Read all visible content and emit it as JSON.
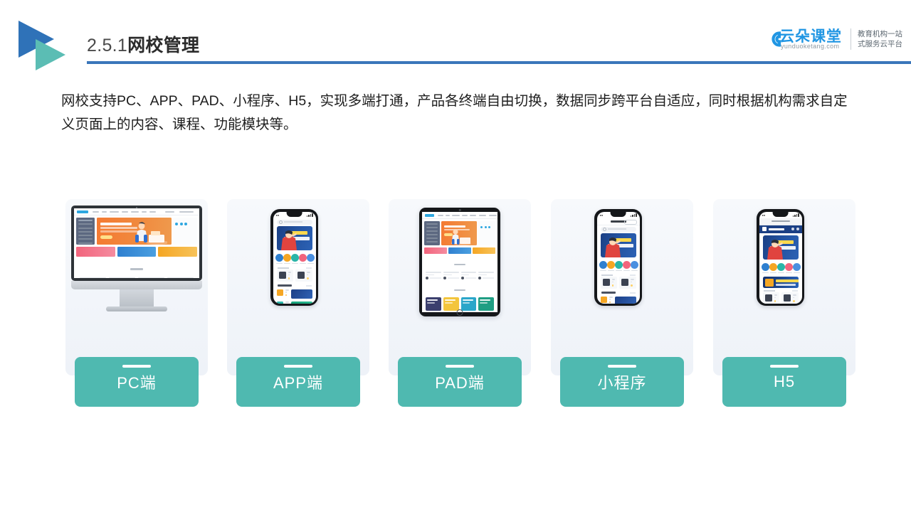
{
  "header": {
    "title_number": "2.5.1",
    "title_zh": "网校管理",
    "rule_color": "#3a76ba",
    "logo_blue": "#2f72b8",
    "logo_teal": "#5bbdb4"
  },
  "brand": {
    "name": "云朵课堂",
    "url": "yunduoketang.com",
    "tagline_line1": "教育机构一站",
    "tagline_line2": "式服务云平台",
    "color": "#2196e3"
  },
  "body": {
    "paragraph": "网校支持PC、APP、PAD、小程序、H5，实现多端打通，产品各终端自由切换，数据同步跨平台自适应，同时根据机构需求自定义页面上的内容、课程、功能模块等。"
  },
  "cards": {
    "accent_color": "#4fb9b0",
    "card_bg": "#f2f5fa",
    "items": [
      {
        "label": "PC端",
        "device": "desktop"
      },
      {
        "label": "APP端",
        "device": "phone"
      },
      {
        "label": "PAD端",
        "device": "tablet"
      },
      {
        "label": "小程序",
        "device": "phone-miniprogram"
      },
      {
        "label": "H5",
        "device": "phone-h5"
      }
    ]
  }
}
